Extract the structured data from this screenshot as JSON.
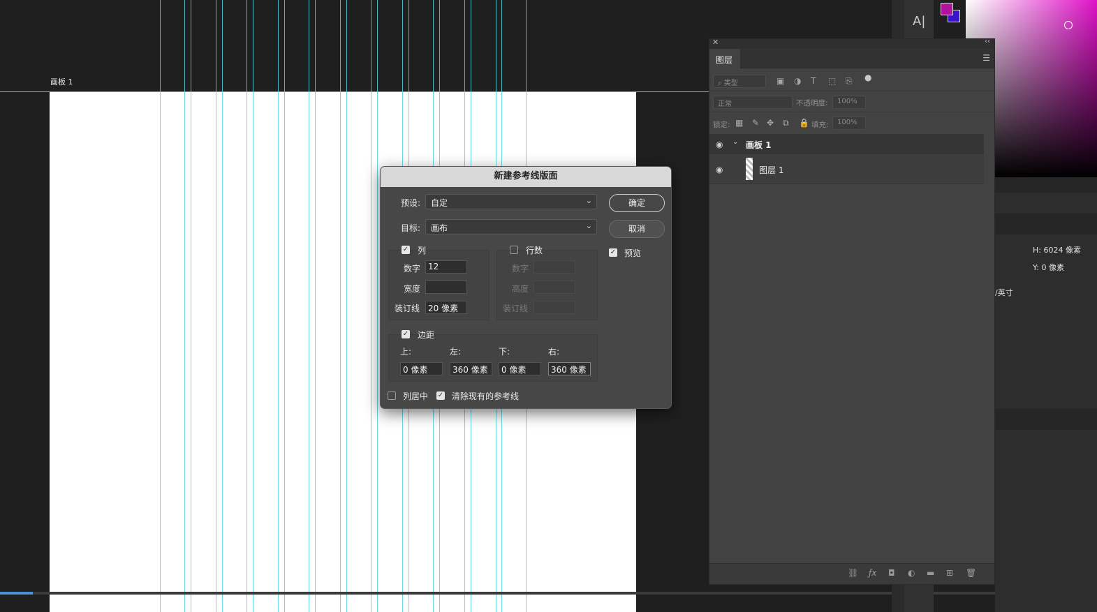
{
  "artboard": {
    "label": "画板 1"
  },
  "tool": {
    "type_tool": "A|"
  },
  "colors": {
    "foreground": "#b0149a",
    "background": "#3a14c8",
    "guide": "#4fd3df"
  },
  "properties": {
    "h_value": "H: 6024 像素",
    "y_value": "Y: 0 像素",
    "unit_fragment": "/英寸"
  },
  "layers_panel": {
    "tab_label": "图层",
    "filter_placeholder": "类型",
    "blend_mode": "正常",
    "opacity_label": "不透明度:",
    "opacity_value": "100%",
    "lock_label": "锁定:",
    "fill_label": "填充:",
    "fill_value": "100%",
    "layers": [
      {
        "name": "画板 1",
        "expanded": true
      },
      {
        "name": "图层 1"
      }
    ]
  },
  "dialog": {
    "title": "新建参考线版面",
    "preset_label": "预设:",
    "preset_value": "自定",
    "target_label": "目标:",
    "target_value": "画布",
    "ok_label": "确定",
    "cancel_label": "取消",
    "preview_label": "预览",
    "preview_checked": true,
    "columns": {
      "label": "列",
      "checked": true,
      "number_label": "数字",
      "number_value": "12",
      "width_label": "宽度",
      "width_value": "",
      "gutter_label": "装订线",
      "gutter_value": "20 像素"
    },
    "rows": {
      "label": "行数",
      "checked": false,
      "number_label": "数字",
      "height_label": "高度",
      "gutter_label": "装订线"
    },
    "margin": {
      "label": "边距",
      "checked": true,
      "top_label": "上:",
      "left_label": "左:",
      "bottom_label": "下:",
      "right_label": "右:",
      "top_value": "0 像素",
      "left_value": "360 像素",
      "bottom_value": "0 像素",
      "right_value": "360 像素"
    },
    "center_columns_label": "列居中",
    "center_columns_checked": false,
    "clear_guides_label": "清除现有的参考线",
    "clear_guides_checked": true
  }
}
